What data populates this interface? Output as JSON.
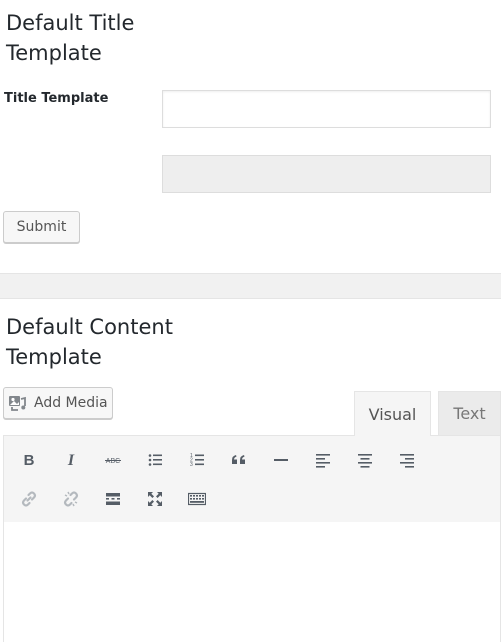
{
  "title_section": {
    "heading": "Default Title Template",
    "field_label": "Title Template",
    "title_input_value": "",
    "secondary_input_value": "",
    "submit_label": "Submit"
  },
  "content_section": {
    "heading": "Default Content Template",
    "add_media_label": "Add Media",
    "tabs": [
      {
        "label": "Visual",
        "active": true
      },
      {
        "label": "Text",
        "active": false
      }
    ],
    "toolbar_row1": [
      "bold-icon",
      "italic-icon",
      "strikethrough-icon",
      "bullet-list-icon",
      "numbered-list-icon",
      "blockquote-icon",
      "horizontal-line-icon",
      "align-left-icon",
      "align-center-icon",
      "align-right-icon"
    ],
    "toolbar_row2": [
      "insert-link-icon",
      "remove-link-icon",
      "read-more-icon",
      "fullscreen-icon",
      "toolbar-toggle-icon"
    ],
    "editor_content": ""
  },
  "colors": {
    "text": "#23282d",
    "icon": "#555d66",
    "toolbar_bg": "#f5f5f5",
    "divider_bg": "#f1f1f1"
  }
}
